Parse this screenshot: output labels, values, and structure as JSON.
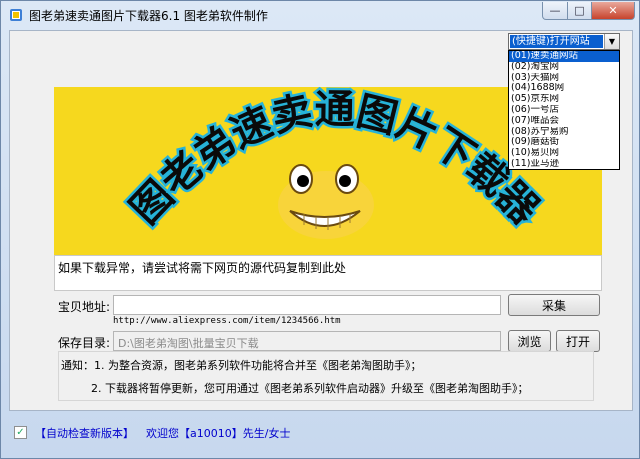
{
  "window": {
    "title": "图老弟速卖通图片下载器6.1   图老弟软件制作",
    "controls": {
      "minimize": "—",
      "maximize": "□",
      "close": "✕"
    }
  },
  "site_select": {
    "value": "(快捷键)打开网站",
    "options": [
      "(01)速卖通网站",
      "(02)淘宝网",
      "(03)天猫网",
      "(04)1688网",
      "(05)京东网",
      "(06)一号店",
      "(07)唯品会",
      "(08)苏宁易购",
      "(09)蘑菇街",
      "(10)易贝网",
      "(11)亚马逊"
    ]
  },
  "banner": {
    "logo_text": "图老弟速卖通图片下载器"
  },
  "notice_box": {
    "text": "如果下载异常，请尝试将需下网页的源代码复制到此处"
  },
  "form": {
    "url_label": "宝贝地址:",
    "url_value": "",
    "url_hint": "http://www.aliexpress.com/item/1234566.htm",
    "collect_button": "采集",
    "save_label": "保存目录:",
    "save_value": "D:\\图老弟淘图\\批量宝贝下载",
    "browse_button": "浏览",
    "open_button": "打开"
  },
  "notices": {
    "line1": "通知：1. 为整合资源，图老弟系列软件功能将合并至《图老弟淘图助手》；",
    "line2": "2. 下载器将暂停更新，您可用通过《图老弟系列软件启动器》升级至《图老弟淘图助手》；"
  },
  "status": {
    "auto_check": "【自动检查新版本】",
    "welcome": "欢迎您【a10010】先生/女士"
  }
}
